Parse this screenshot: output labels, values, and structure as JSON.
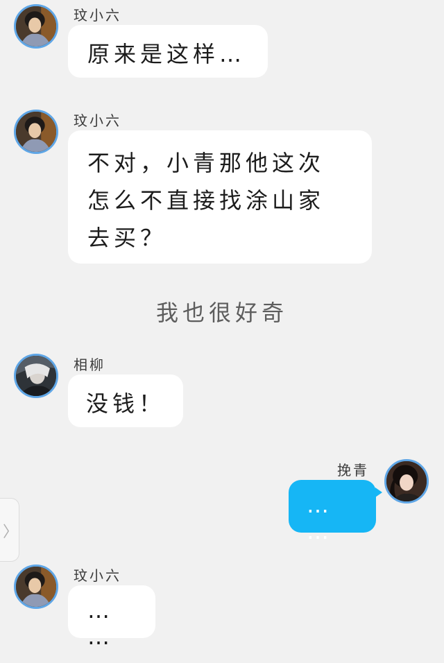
{
  "messages": [
    {
      "sender": "玟小六",
      "avatar": "avatar-wen-xiaoliu",
      "text": "原来是这样…",
      "side": "left"
    },
    {
      "sender": "玟小六",
      "avatar": "avatar-wen-xiaoliu",
      "text": "不对，小青那他这次\n怎么不直接找涂山家\n去买？",
      "side": "left"
    },
    {
      "caption": "我也很好奇"
    },
    {
      "sender": "相柳",
      "avatar": "avatar-xiangliu",
      "text": "没钱！",
      "side": "left"
    },
    {
      "sender": "挽青",
      "avatar": "avatar-wanqing",
      "text": "… …",
      "side": "right"
    },
    {
      "sender": "玟小六",
      "avatar": "avatar-wen-xiaoliu",
      "text": "… …",
      "side": "left"
    }
  ],
  "side_tab": {
    "icon": "chevron-right-icon",
    "glyph": "〉"
  },
  "colors": {
    "background": "#f1f1f1",
    "bubble_incoming": "#ffffff",
    "bubble_outgoing": "#16b6f5",
    "avatar_ring": "#5fa6e6"
  }
}
